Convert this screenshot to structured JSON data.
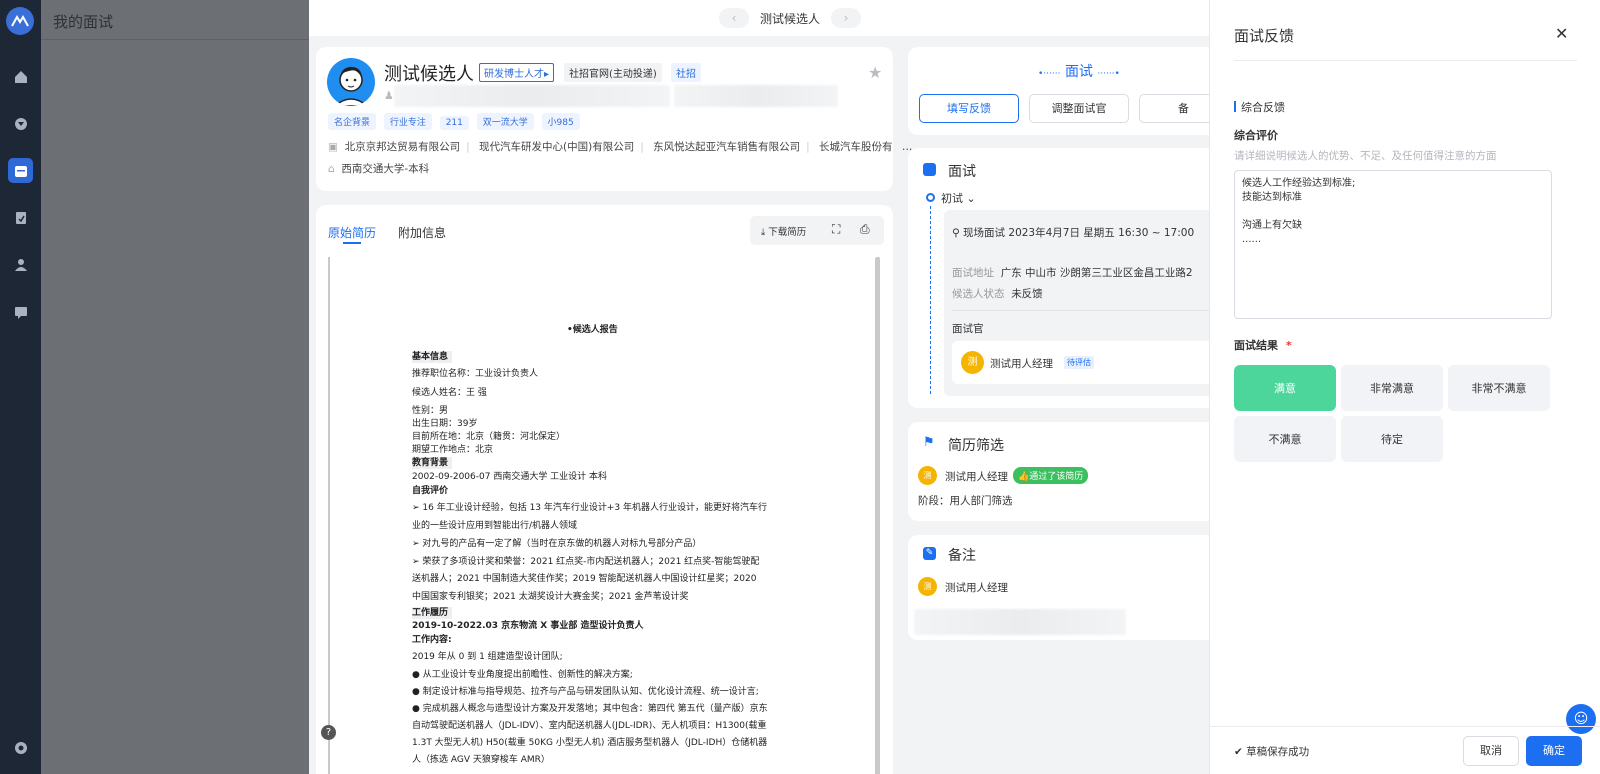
{
  "app": {
    "page_title": "我的面试"
  },
  "header": {
    "title": "测试候选人",
    "prev_icon": "chevron-left",
    "next_icon": "chevron-right"
  },
  "candidate": {
    "name": "测试候选人",
    "tag_research": "研发博士人才",
    "source": "社招官网(主动投递)",
    "type": "社招",
    "labels": [
      "名企背景",
      "行业专注",
      "211",
      "双一流大学",
      "小985"
    ],
    "companies": [
      "北京京邦达贸易有限公司",
      "现代汽车研发中心(中国)有限公司",
      "东风悦达起亚汽车销售有限公司",
      "长城汽车股份有"
    ],
    "more": "…",
    "education": "西南交通大学-本科"
  },
  "resume_tabs": {
    "original": "原始简历",
    "extra": "附加信息",
    "download": "下载简历"
  },
  "resume": {
    "title": "•候选人报告",
    "basic_h": "基本信息",
    "lines1": [
      "推荐职位名称：工业设计负责人",
      "候选人姓名：王 强",
      "性别：男",
      "出生日期：39岁",
      "目前所在地：北京（籍贯：河北保定）",
      "期望工作地点：北京"
    ],
    "edu_h": "教育背景",
    "edu_line": "2002-09-2006-07      西南交通大学      工业设计             本科",
    "self_h": "自我评价",
    "self_lines": [
      "➢   16 年工业设计经验，包括 13 年汽车行业设计+3 年机器人行业设计，能更好将汽车行",
      "      业的一些设计应用到智能出行/机器人领域",
      "➢   对九号的产品有一定了解（当时在京东做的机器人对标九号部分产品）",
      "➢   荣获了多项设计奖和荣誉：2021 红点奖-市内配送机器人；2021 红点奖-智能驾驶配",
      "      送机器人；2021 中国制造大奖佳作奖；2019 智能配送机器人中国设计红星奖；2020",
      "      中国国家专利银奖；2021 太湖奖设计大赛金奖；2021 金芦苇设计奖"
    ],
    "work_h": "工作履历",
    "work_line": "2019-10-2022.03      京东物流 X 事业部        造型设计负责人",
    "work_content": "工作内容:",
    "work_lines": [
      "2019  年从  0  到  1  组建造型设计团队;",
      "●  从工业设计专业角度提出前瞻性、创新性的解决方案;",
      "●  制定设计标准与指导规范、拉齐与产品与研发团队认知、优化设计流程、统一设计言;",
      "●  完成机器人概念与造型设计方案及开发落地；其中包含：第四代  第五代（量产版）京东",
      "自动驾驶配送机器人（JDL-IDV）、室内配送机器人(JDL-IDR)、无人机项目：H1300(载重",
      "1.3T  大型无人机) H50(载重  50KG  小型无人机)  酒店服务型机器人（JDL-IDH）仓储机器",
      "人（拣选  AGV  天狼穿梭车  AMR）"
    ]
  },
  "interview": {
    "header": "面试",
    "btn_fill": "填写反馈",
    "btn_adjust": "调整面试官",
    "btn_partial": "备",
    "section": "面试",
    "round": "初试",
    "datetime": "现场面试 2023年4月7日 星期五 16:30 ~ 17:00",
    "addr_label": "面试地址",
    "addr_value": "广东 中山市 沙朗第三工业区金昌工业路2",
    "status_label": "候选人状态",
    "status_value": "未反馈",
    "interviewer_label": "面试官",
    "interviewer_avatar": "测",
    "interviewer_name": "测试用人经理",
    "interviewer_badge": "待评估"
  },
  "screening": {
    "title": "简历筛选",
    "avatar": "测",
    "name": "测试用人经理",
    "badge": "通过了该简历",
    "stage": "阶段：用人部门筛选"
  },
  "notes": {
    "title": "备注",
    "avatar": "测",
    "name": "测试用人经理"
  },
  "feedback": {
    "title": "面试反馈",
    "section": "综合反馈",
    "eval_label": "综合评价",
    "eval_hint": "请详细说明候选人的优势、不足、及任何值得注意的方面",
    "eval_text": "候选人工作经验达到标准;\n技能达到标准\n\n沟通上有欠缺\n......",
    "result_label": "面试结果",
    "required_mark": "*",
    "options": [
      "满意",
      "非常满意",
      "非常不满意",
      "不满意",
      "待定"
    ],
    "draft_status": "草稿保存成功",
    "cancel": "取消",
    "confirm": "确定"
  },
  "colors": {
    "primary": "#1d6ff2",
    "selected": "#4cd69c",
    "rail": "#1e2736",
    "badge_green": "#3cbf5e",
    "avatar_orange": "#f5b400"
  }
}
